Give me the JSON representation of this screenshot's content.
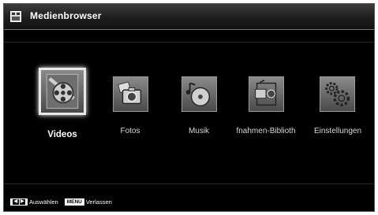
{
  "header": {
    "title": "Medienbrowser",
    "icon": "media-browser-icon"
  },
  "menu": {
    "items": [
      {
        "label": "Videos",
        "icon": "film-reel-icon",
        "selected": true
      },
      {
        "label": "Fotos",
        "icon": "photo-camera-icon",
        "selected": false
      },
      {
        "label": "Musik",
        "icon": "music-disc-icon",
        "selected": false
      },
      {
        "label": "fnahmen-Biblioth",
        "icon": "recording-library-icon",
        "selected": false
      },
      {
        "label": "Einstellungen",
        "icon": "settings-gears-icon",
        "selected": false
      }
    ]
  },
  "footer": {
    "navigate_key_left": "◀",
    "navigate_key_right": "▶",
    "navigate_label": "Auswählen",
    "menu_key": "MENU",
    "menu_label": "Verlassen"
  },
  "colors": {
    "background": "#000000",
    "tile": "#7a7a7a",
    "selected_border": "#e8e8e8"
  }
}
